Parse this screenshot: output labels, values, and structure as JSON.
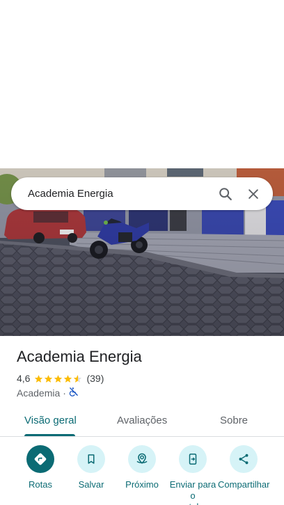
{
  "search": {
    "query": "Academia Energia",
    "search_icon": "search-icon",
    "close_icon": "close-icon"
  },
  "place": {
    "name": "Academia Energia",
    "rating": "4,6",
    "stars": 4.6,
    "review_count": "(39)",
    "category": "Academia",
    "separator": "·",
    "accessibility_icon": "not-wheelchair-accessible-icon"
  },
  "tabs": [
    {
      "label": "Visão geral",
      "active": true
    },
    {
      "label": "Avaliações",
      "active": false
    },
    {
      "label": "Sobre",
      "active": false
    }
  ],
  "actions": [
    {
      "label": "Rotas",
      "icon": "directions-icon"
    },
    {
      "label": "Salvar",
      "icon": "bookmark-icon"
    },
    {
      "label": "Próximo",
      "icon": "nearby-icon"
    },
    {
      "label": "Enviar para o\nsmartphone",
      "icon": "send-to-phone-icon"
    },
    {
      "label": "Compartilhar",
      "icon": "share-icon"
    }
  ],
  "colors": {
    "accent": "#0b6b74",
    "accent_light": "#d6f3f7",
    "star": "#fbbc04"
  }
}
